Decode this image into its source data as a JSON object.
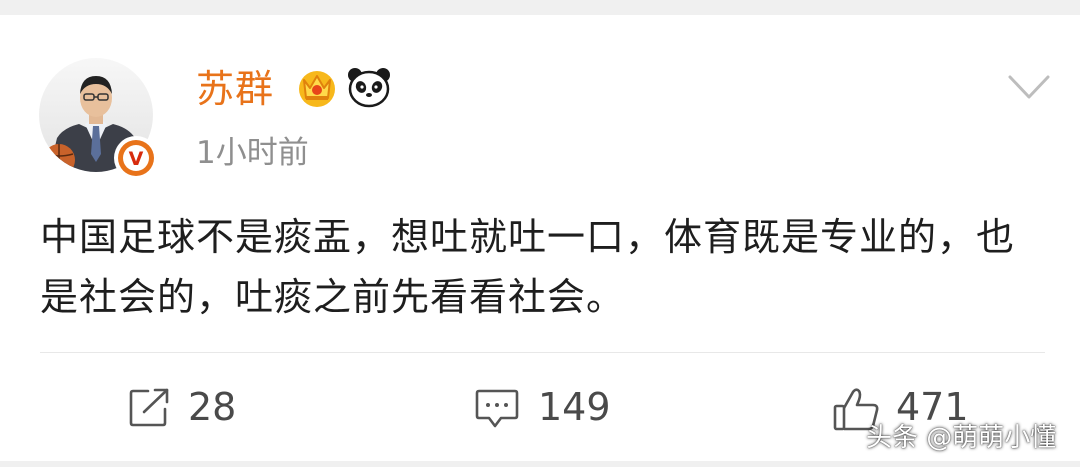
{
  "post": {
    "author": {
      "name": "苏群",
      "verified_badge": "V",
      "badges": [
        "crown-icon",
        "panda-icon"
      ]
    },
    "timestamp": "1小时前",
    "text": "中国足球不是痰盂，想吐就吐一口，体育既是专业的，也是社会的，吐痰之前先看看社会。"
  },
  "actions": {
    "repost_count": "28",
    "comment_count": "149",
    "like_count": "471"
  },
  "watermark": "头条 @萌萌小懂",
  "colors": {
    "username": "#e8731a",
    "verified": "#e8731a",
    "timestamp": "#8f8f8f",
    "text": "#1e1e1e",
    "action": "#4a4a4a"
  }
}
